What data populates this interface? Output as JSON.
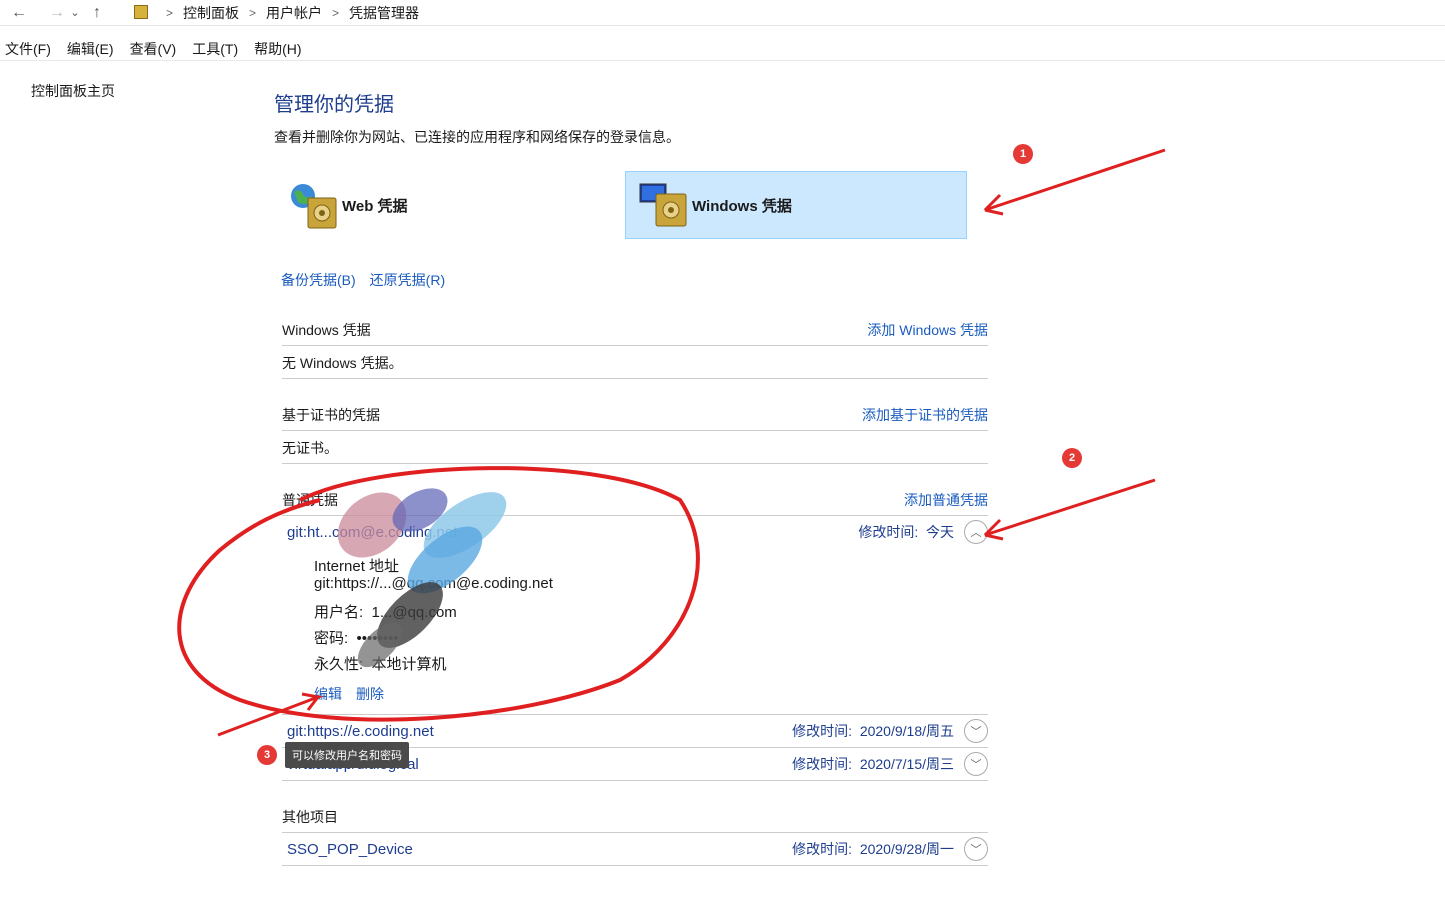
{
  "breadcrumb": [
    "控制面板",
    "用户帐户",
    "凭据管理器"
  ],
  "menu": [
    "文件(F)",
    "编辑(E)",
    "查看(V)",
    "工具(T)",
    "帮助(H)"
  ],
  "sidebar": {
    "home_link": "控制面板主页"
  },
  "page": {
    "title": "管理你的凭据",
    "description": "查看并删除你为网站、已连接的应用程序和网络保存的登录信息。"
  },
  "tabs": {
    "web": "Web 凭据",
    "windows": "Windows 凭据"
  },
  "actions": {
    "backup": "备份凭据(B)",
    "restore": "还原凭据(R)"
  },
  "windows_section": {
    "title": "Windows 凭据",
    "add": "添加 Windows 凭据",
    "empty": "无 Windows 凭据。"
  },
  "cert_section": {
    "title": "基于证书的凭据",
    "add": "添加基于证书的凭据",
    "empty": "无证书。"
  },
  "generic_section": {
    "title": "普通凭据",
    "add": "添加普通凭据",
    "entries": [
      {
        "name": "git:ht...com@e.coding.net",
        "modified_label": "修改时间:",
        "modified": "今天"
      },
      {
        "name": "git:https://e.coding.net",
        "modified_label": "修改时间:",
        "modified": "2020/9/18/周五"
      },
      {
        "name": "virtualapp/didlogical",
        "modified_label": "修改时间:",
        "modified": "2020/7/15/周三"
      }
    ],
    "details": {
      "internet_label": "Internet 地址",
      "address": "git:https://...@qq.com@e.coding.net",
      "user_label": "用户名:",
      "user": "1...@qq.com",
      "password_label": "密码:",
      "password": "••••••••",
      "persistence_label": "永久性:",
      "persistence": "本地计算机",
      "edit": "编辑",
      "delete": "删除"
    }
  },
  "other_section": {
    "title": "其他项目",
    "entries": [
      {
        "name": "SSO_POP_Device",
        "modified_label": "修改时间:",
        "modified": "2020/9/28/周一"
      }
    ]
  },
  "tooltip": "可以修改用户名和密码",
  "annotations": [
    "1",
    "2",
    "3"
  ],
  "colors": {
    "accent": "#1e3d8f",
    "link": "#1a5bbf",
    "selected_tab": "#cce8ff",
    "annotation": "#e53935"
  }
}
